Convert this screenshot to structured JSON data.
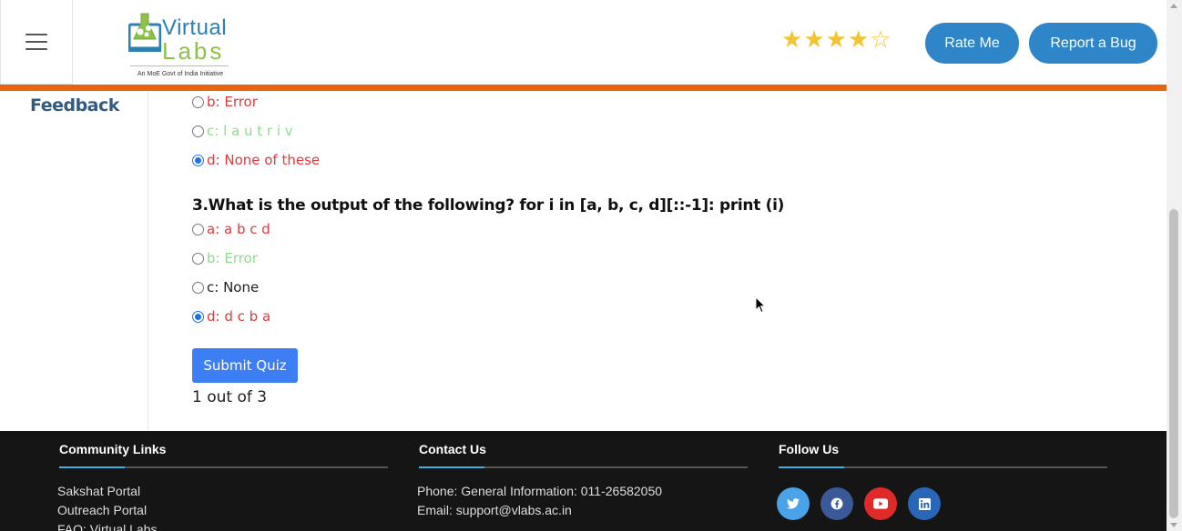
{
  "header": {
    "logo": {
      "word1": "Virtual",
      "word2": "Labs",
      "tagline": "An MoE Govt of India Initiative"
    },
    "rating": {
      "filled": 4,
      "total": 5
    },
    "rate_label": "Rate Me",
    "bug_label": "Report a Bug",
    "accent_color": "#e8650e",
    "button_color": "#2e86c8"
  },
  "sidebar": {
    "feedback_label": "Feedback"
  },
  "quiz": {
    "prev_options": [
      {
        "label": "b: Error",
        "state": "wrong",
        "checked": false
      },
      {
        "label": "c: l a u t r i v",
        "state": "correct",
        "checked": false
      },
      {
        "label": "d: None of these",
        "state": "wrong",
        "checked": true
      }
    ],
    "question": "3.What is the output of the following? for i in [a, b, c, d][::-1]: print (i)",
    "options": [
      {
        "label": "a: a b c d",
        "state": "wrong",
        "checked": false
      },
      {
        "label": "b: Error",
        "state": "correct",
        "checked": false
      },
      {
        "label": "c: None",
        "state": "neutral",
        "checked": false
      },
      {
        "label": "d: d c b a",
        "state": "wrong",
        "checked": true
      }
    ],
    "submit_label": "Submit Quiz",
    "score": "1 out of 3"
  },
  "footer": {
    "community": {
      "title": "Community Links",
      "links": [
        "Sakshat Portal",
        "Outreach Portal",
        "FAQ: Virtual Labs"
      ]
    },
    "contact": {
      "title": "Contact Us",
      "phone": "Phone: General Information: 011-26582050",
      "email": "Email: support@vlabs.ac.in"
    },
    "follow": {
      "title": "Follow Us",
      "icons": [
        "twitter-icon",
        "facebook-icon",
        "youtube-icon",
        "linkedin-icon"
      ]
    }
  }
}
